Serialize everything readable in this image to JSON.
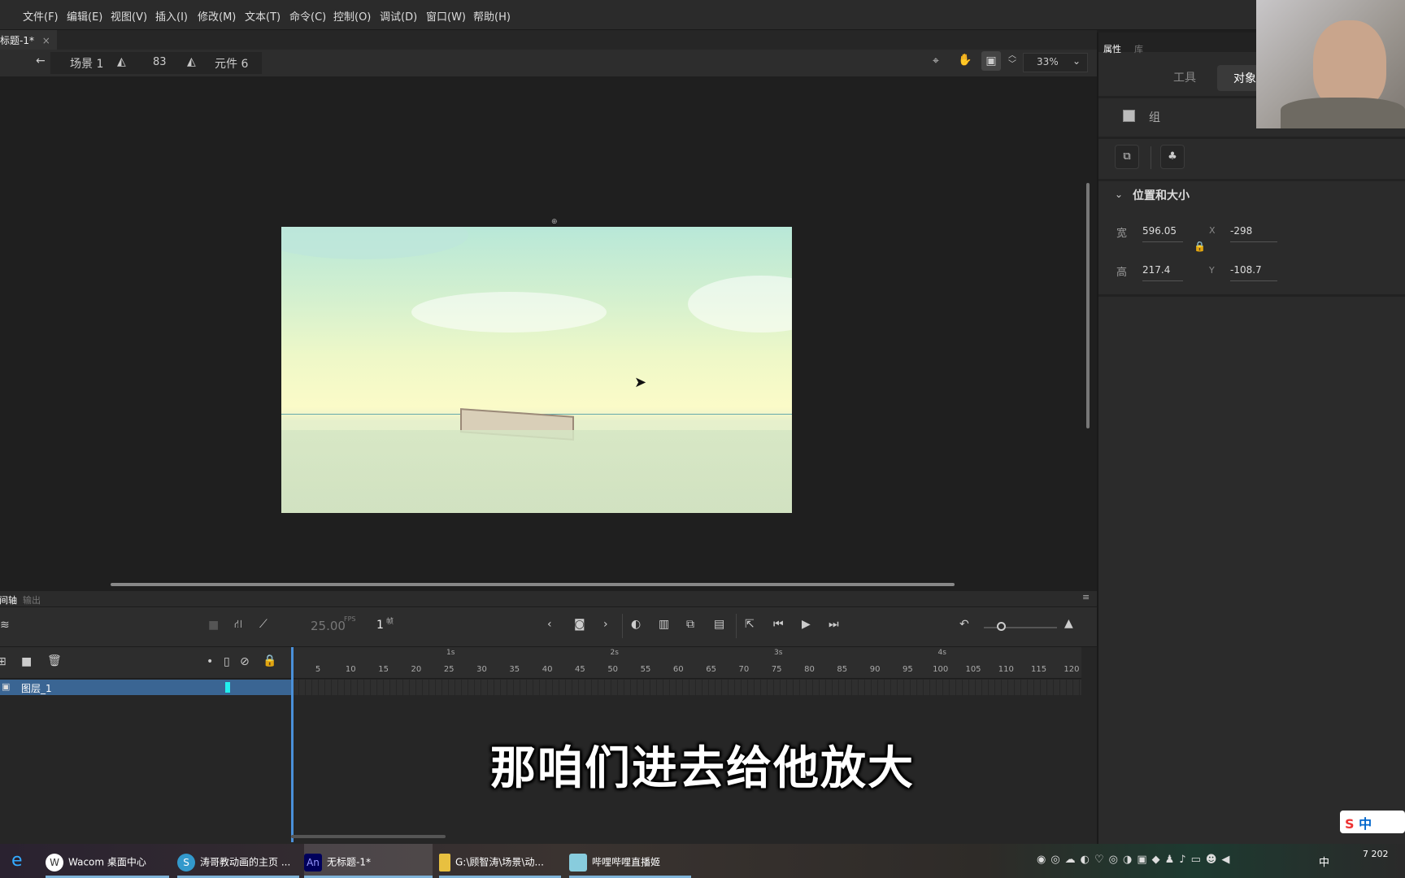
{
  "menu": [
    "文件(F)",
    "编辑(E)",
    "视图(V)",
    "插入(I)",
    "修改(M)",
    "文本(T)",
    "命令(C)",
    "控制(O)",
    "调试(D)",
    "窗口(W)",
    "帮助(H)"
  ],
  "doc_tab": {
    "title": "标题-1*",
    "close": "×"
  },
  "toolbar": {
    "scene": "场景 1",
    "symbol_a": "83",
    "symbol_b": "元件 6",
    "zoom": "33%"
  },
  "panel": {
    "tabs": [
      "属性",
      "库"
    ],
    "subtabs": [
      "工具",
      "对象"
    ],
    "object_type": "组",
    "section": "位置和大小",
    "width_label": "宽",
    "width": "596.05",
    "height_label": "高",
    "height": "217.4",
    "x_label": "X",
    "x": "-298",
    "y_label": "Y",
    "y": "-108.7"
  },
  "timeline": {
    "tabs": [
      "时间轴",
      "输出"
    ],
    "fps": "25.00",
    "fps_unit": "FPS",
    "frame": "1",
    "frame_unit": "帧",
    "layer": "图层_1",
    "seconds": [
      "1s",
      "2s",
      "3s",
      "4s"
    ],
    "frames": [
      "5",
      "10",
      "15",
      "20",
      "25",
      "30",
      "35",
      "40",
      "45",
      "50",
      "55",
      "60",
      "65",
      "70",
      "75",
      "80",
      "85",
      "90",
      "95",
      "100",
      "105",
      "110",
      "115",
      "120"
    ]
  },
  "subtitle": "那咱们进去给他放大",
  "taskbar": {
    "items": [
      "Wacom 桌面中心",
      "涛哥教动画的主页 ...",
      "无标题-1*",
      "G:\\顾智涛\\场景\\动...",
      "哔哩哔哩直播姬"
    ],
    "ime": "中",
    "clock": "7 202"
  }
}
